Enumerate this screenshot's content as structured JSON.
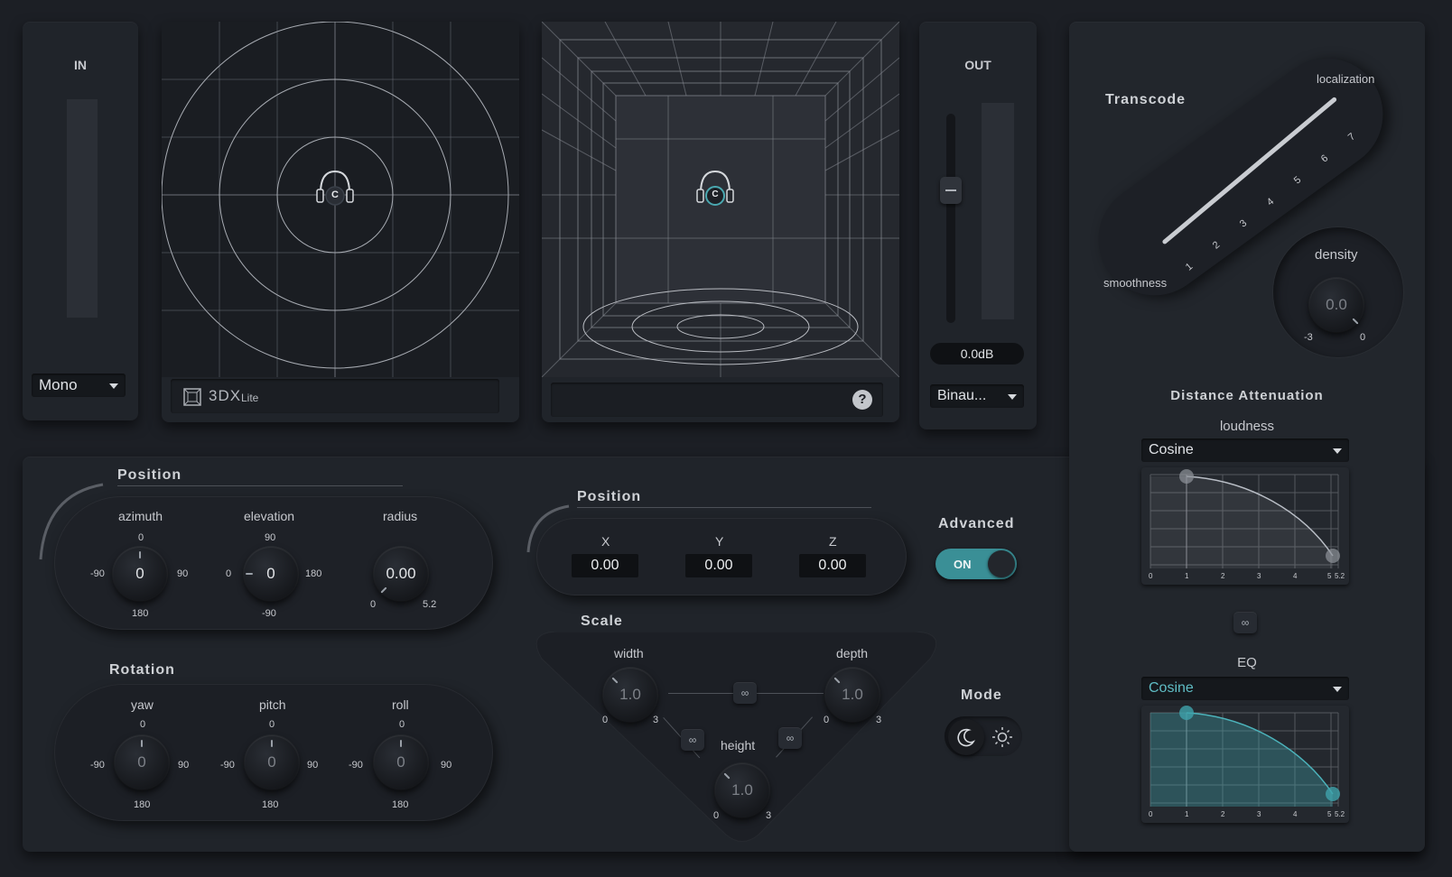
{
  "input": {
    "title": "IN",
    "mode": "Mono"
  },
  "output": {
    "title": "OUT",
    "gain": "0.0dB",
    "mode": "Binau..."
  },
  "top_view": {
    "brand": "3DX",
    "brand_suffix": "Lite",
    "source_label": "C"
  },
  "room_view": {
    "source_label": "C",
    "help": "?"
  },
  "transcode": {
    "title": "Transcode",
    "label_high": "localization",
    "label_low": "smoothness",
    "scale": [
      "1",
      "2",
      "3",
      "4",
      "5",
      "6",
      "7"
    ],
    "density_label": "density",
    "density_value": "0.0",
    "density_min": "-3",
    "density_max": "0"
  },
  "distance": {
    "title": "Distance Attenuation",
    "loudness_label": "loudness",
    "loudness_curve": "Cosine",
    "eq_label": "EQ",
    "eq_curve": "Cosine",
    "axis": [
      "0",
      "1",
      "2",
      "3",
      "4",
      "5",
      "5.2"
    ],
    "loudness_curve_color": "#b9bec6",
    "eq_curve_color": "#3fa3ab"
  },
  "position": {
    "title": "Position",
    "azimuth": {
      "label": "azimuth",
      "value": "0",
      "top": "0",
      "left": "-90",
      "right": "90",
      "bottom": "180"
    },
    "elevation": {
      "label": "elevation",
      "value": "0",
      "top": "90",
      "left": "0",
      "right": "180",
      "bottom": "-90"
    },
    "radius": {
      "label": "radius",
      "value": "0.00",
      "min": "0",
      "max": "5.2"
    }
  },
  "rotation": {
    "title": "Rotation",
    "yaw": {
      "label": "yaw",
      "value": "0",
      "top": "0",
      "left": "-90",
      "right": "90",
      "bottom": "180"
    },
    "pitch": {
      "label": "pitch",
      "value": "0",
      "top": "0",
      "left": "-90",
      "right": "90",
      "bottom": "180"
    },
    "roll": {
      "label": "roll",
      "value": "0",
      "top": "0",
      "left": "-90",
      "right": "90",
      "bottom": "180"
    }
  },
  "position_xyz": {
    "title": "Position",
    "x_label": "X",
    "x_value": "0.00",
    "y_label": "Y",
    "y_value": "0.00",
    "z_label": "Z",
    "z_value": "0.00"
  },
  "scale": {
    "title": "Scale",
    "width": {
      "label": "width",
      "value": "1.0",
      "min": "0",
      "max": "3"
    },
    "depth": {
      "label": "depth",
      "value": "1.0",
      "min": "0",
      "max": "3"
    },
    "height": {
      "label": "height",
      "value": "1.0",
      "min": "0",
      "max": "3"
    }
  },
  "advanced": {
    "title": "Advanced",
    "state": "ON",
    "accent": "#3a8f96"
  },
  "mode": {
    "title": "Mode",
    "dark_icon": "moon-icon",
    "light_icon": "sun-icon"
  }
}
